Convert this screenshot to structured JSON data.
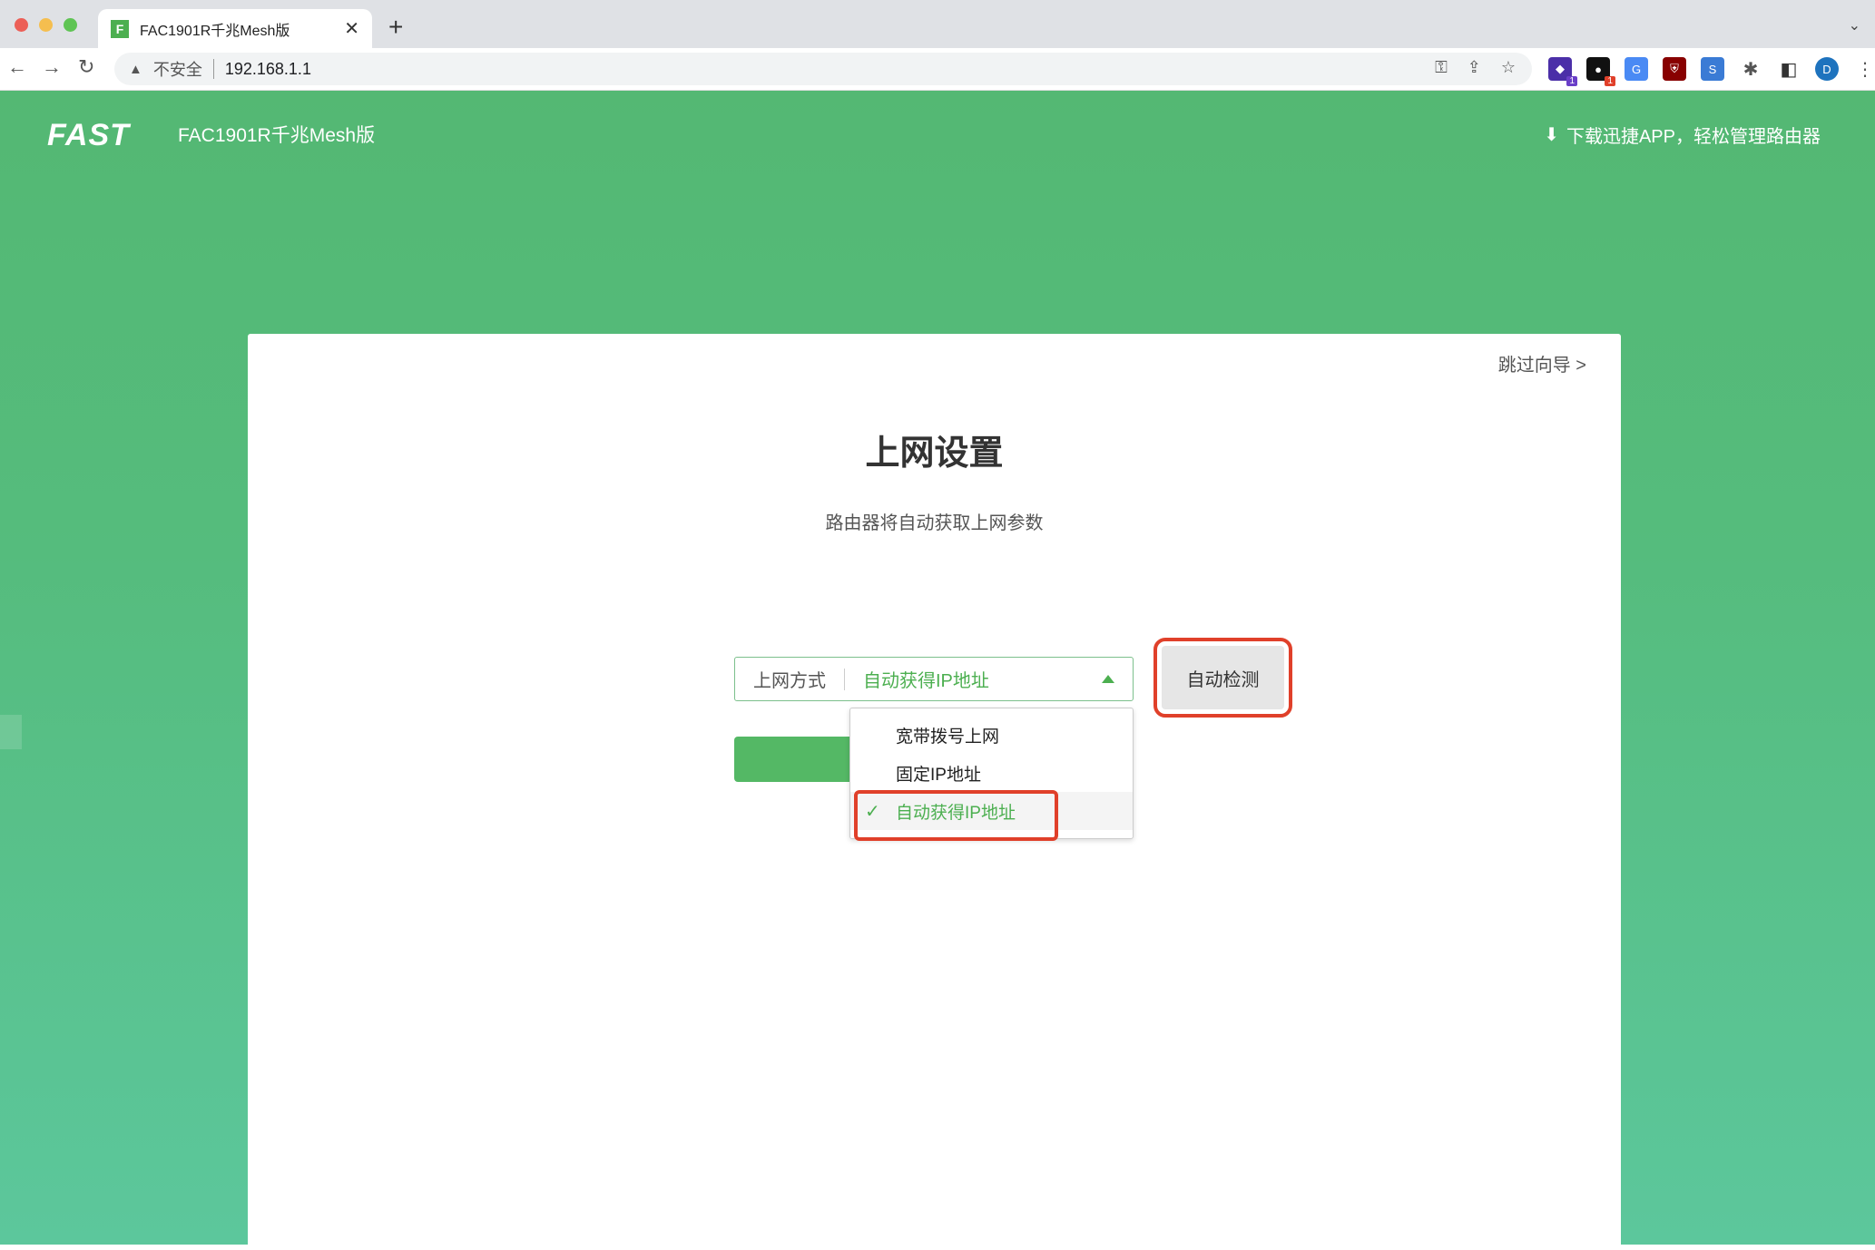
{
  "browser": {
    "tab_title": "FAC1901R千兆Mesh版",
    "favicon_letter": "F",
    "security_label": "不安全",
    "url": "192.168.1.1",
    "ext_badges": [
      "1",
      "1"
    ]
  },
  "header": {
    "logo": "FAST",
    "model": "FAC1901R千兆Mesh版",
    "download_text": "下载迅捷APP，轻松管理路由器"
  },
  "card": {
    "skip_link": "跳过向导 >",
    "title": "上网设置",
    "subtitle": "路由器将自动获取上网参数",
    "select_label": "上网方式",
    "select_value": "自动获得IP地址",
    "detect_button": "自动检测",
    "options": [
      "宽带拨号上网",
      "固定IP地址",
      "自动获得IP地址"
    ],
    "selected_index": 2
  },
  "colors": {
    "accent": "#4caf50",
    "highlight": "#e0402a"
  }
}
